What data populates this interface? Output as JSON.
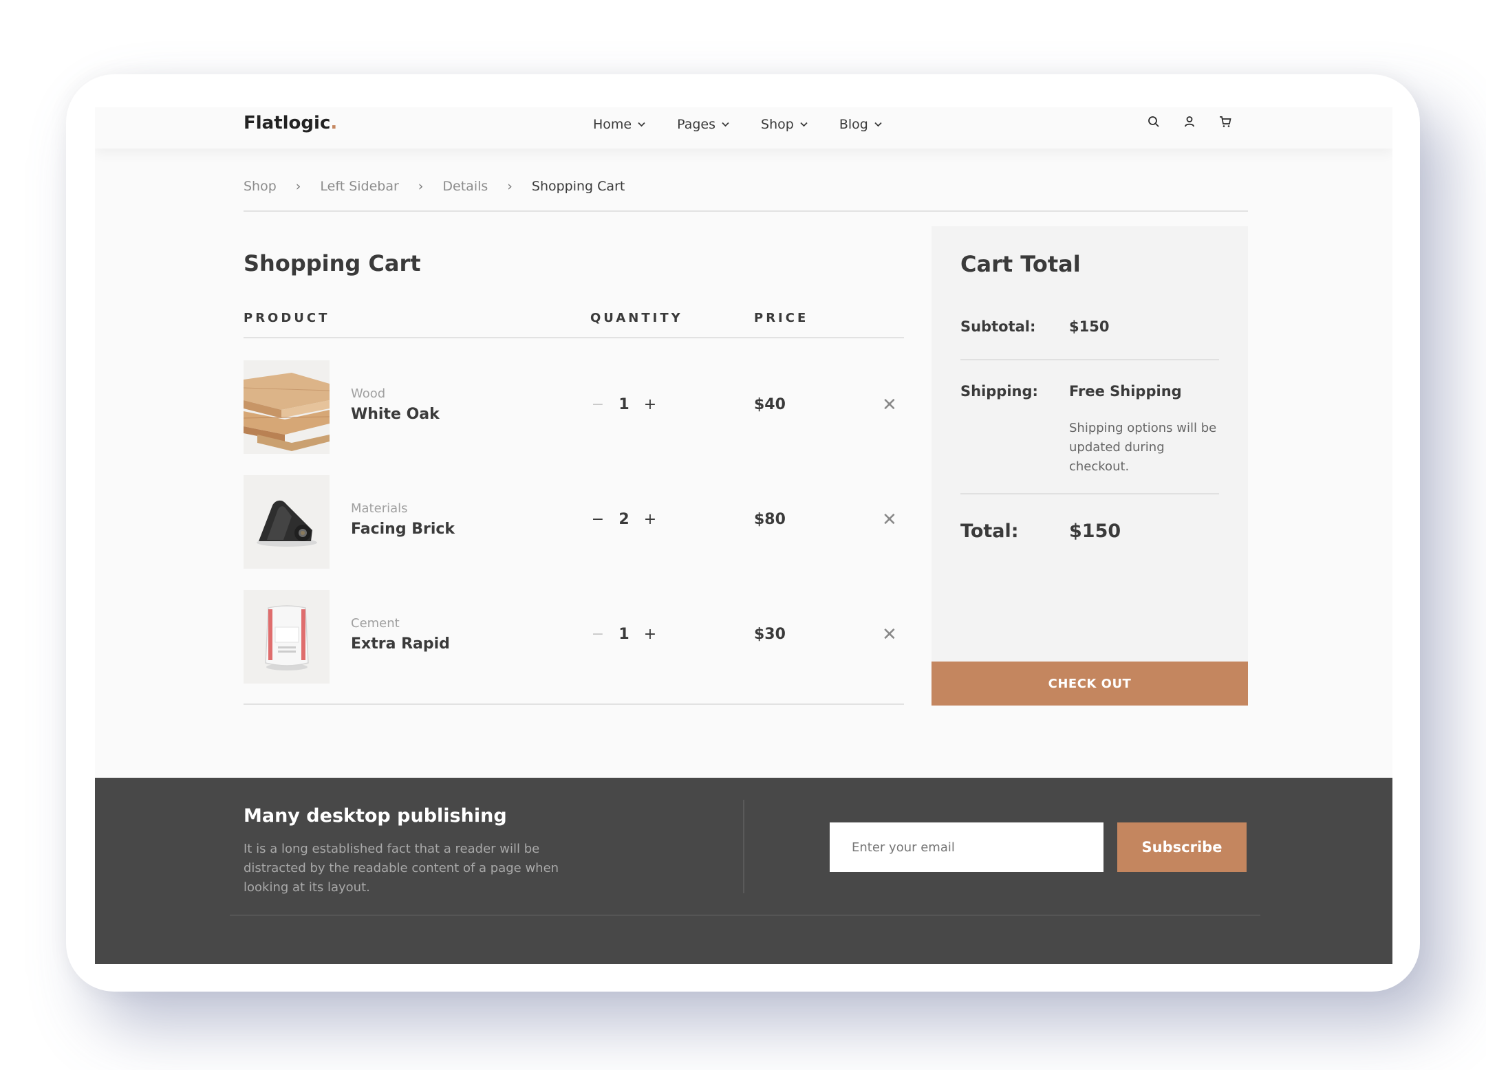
{
  "brand": {
    "name": "Flatlogic",
    "dot": ".",
    "accent_color": "#c4865f"
  },
  "nav": {
    "items": [
      {
        "label": "Home",
        "icon": "chevron-down-icon"
      },
      {
        "label": "Pages",
        "icon": "chevron-down-icon"
      },
      {
        "label": "Shop",
        "icon": "chevron-down-icon"
      },
      {
        "label": "Blog",
        "icon": "chevron-down-icon"
      }
    ]
  },
  "header_icons": [
    "search-icon",
    "user-icon",
    "cart-icon"
  ],
  "breadcrumb": {
    "items": [
      "Shop",
      "Left Sidebar",
      "Details"
    ],
    "current": "Shopping Cart",
    "separator": "›"
  },
  "cart": {
    "title": "Shopping Cart",
    "columns": {
      "product": "PRODUCT",
      "quantity": "QUANTITY",
      "price": "PRICE"
    },
    "items": [
      {
        "category": "Wood",
        "name": "White Oak",
        "quantity": "1",
        "price": "$40",
        "image": "wood-planks-image"
      },
      {
        "category": "Materials",
        "name": "Facing Brick",
        "quantity": "2",
        "price": "$80",
        "image": "rubber-roll-image"
      },
      {
        "category": "Cement",
        "name": "Extra Rapid",
        "quantity": "1",
        "price": "$30",
        "image": "cement-bag-image"
      }
    ],
    "minus_symbol": "−",
    "plus_symbol": "+",
    "remove_symbol": "✕"
  },
  "summary": {
    "title": "Cart Total",
    "subtotal_label": "Subtotal:",
    "subtotal_value": "$150",
    "shipping_label": "Shipping:",
    "shipping_value": "Free Shipping",
    "shipping_note": "Shipping options will be updated during checkout.",
    "total_label": "Total:",
    "total_value": "$150",
    "checkout_label": "CHECK OUT"
  },
  "footer": {
    "title": "Many desktop publishing",
    "text": "It is a long established fact that a reader will be distracted by the readable content of a page when looking at its layout.",
    "email_placeholder": "Enter your email",
    "subscribe_label": "Subscribe"
  }
}
